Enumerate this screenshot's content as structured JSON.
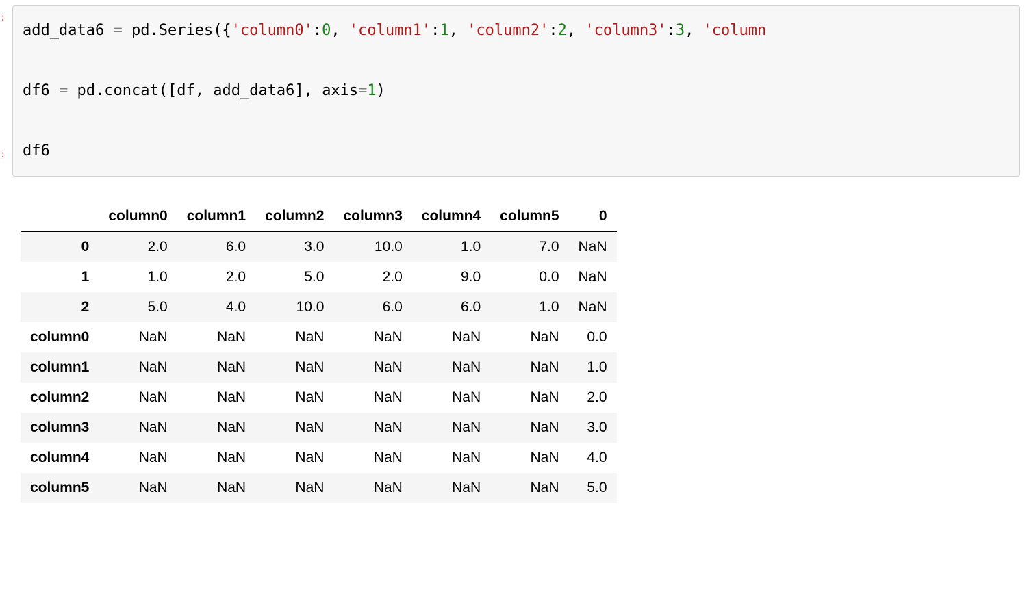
{
  "code": {
    "tokens_line1": [
      {
        "t": "add_data6 ",
        "c": "tok-var"
      },
      {
        "t": "=",
        "c": "tok-op"
      },
      {
        "t": " pd",
        "c": "tok-var"
      },
      {
        "t": ".",
        "c": "tok-punc"
      },
      {
        "t": "Series",
        "c": "tok-var"
      },
      {
        "t": "({",
        "c": "tok-punc"
      },
      {
        "t": "'column0'",
        "c": "tok-str"
      },
      {
        "t": ":",
        "c": "tok-punc"
      },
      {
        "t": "0",
        "c": "tok-num"
      },
      {
        "t": ", ",
        "c": "tok-punc"
      },
      {
        "t": "'column1'",
        "c": "tok-str"
      },
      {
        "t": ":",
        "c": "tok-punc"
      },
      {
        "t": "1",
        "c": "tok-num"
      },
      {
        "t": ", ",
        "c": "tok-punc"
      },
      {
        "t": "'column2'",
        "c": "tok-str"
      },
      {
        "t": ":",
        "c": "tok-punc"
      },
      {
        "t": "2",
        "c": "tok-num"
      },
      {
        "t": ", ",
        "c": "tok-punc"
      },
      {
        "t": "'column3'",
        "c": "tok-str"
      },
      {
        "t": ":",
        "c": "tok-punc"
      },
      {
        "t": "3",
        "c": "tok-num"
      },
      {
        "t": ", ",
        "c": "tok-punc"
      },
      {
        "t": "'column",
        "c": "tok-str"
      }
    ],
    "tokens_line2": [
      {
        "t": "df6 ",
        "c": "tok-var"
      },
      {
        "t": "=",
        "c": "tok-op"
      },
      {
        "t": " pd",
        "c": "tok-var"
      },
      {
        "t": ".",
        "c": "tok-punc"
      },
      {
        "t": "concat",
        "c": "tok-var"
      },
      {
        "t": "([",
        "c": "tok-punc"
      },
      {
        "t": "df",
        "c": "tok-var"
      },
      {
        "t": ", ",
        "c": "tok-punc"
      },
      {
        "t": "add_data6",
        "c": "tok-var"
      },
      {
        "t": "], ",
        "c": "tok-punc"
      },
      {
        "t": "axis",
        "c": "tok-var"
      },
      {
        "t": "=",
        "c": "tok-op"
      },
      {
        "t": "1",
        "c": "tok-num"
      },
      {
        "t": ")",
        "c": "tok-punc"
      }
    ],
    "tokens_line3": [
      {
        "t": "df6",
        "c": "tok-var"
      }
    ]
  },
  "table": {
    "columns": [
      "column0",
      "column1",
      "column2",
      "column3",
      "column4",
      "column5",
      "0"
    ],
    "index": [
      "0",
      "1",
      "2",
      "column0",
      "column1",
      "column2",
      "column3",
      "column4",
      "column5"
    ],
    "rows": [
      [
        "2.0",
        "6.0",
        "3.0",
        "10.0",
        "1.0",
        "7.0",
        "NaN"
      ],
      [
        "1.0",
        "2.0",
        "5.0",
        "2.0",
        "9.0",
        "0.0",
        "NaN"
      ],
      [
        "5.0",
        "4.0",
        "10.0",
        "6.0",
        "6.0",
        "1.0",
        "NaN"
      ],
      [
        "NaN",
        "NaN",
        "NaN",
        "NaN",
        "NaN",
        "NaN",
        "0.0"
      ],
      [
        "NaN",
        "NaN",
        "NaN",
        "NaN",
        "NaN",
        "NaN",
        "1.0"
      ],
      [
        "NaN",
        "NaN",
        "NaN",
        "NaN",
        "NaN",
        "NaN",
        "2.0"
      ],
      [
        "NaN",
        "NaN",
        "NaN",
        "NaN",
        "NaN",
        "NaN",
        "3.0"
      ],
      [
        "NaN",
        "NaN",
        "NaN",
        "NaN",
        "NaN",
        "NaN",
        "4.0"
      ],
      [
        "NaN",
        "NaN",
        "NaN",
        "NaN",
        "NaN",
        "NaN",
        "5.0"
      ]
    ]
  },
  "gutter": {
    "in_stub": ":",
    "out_stub": ":"
  }
}
